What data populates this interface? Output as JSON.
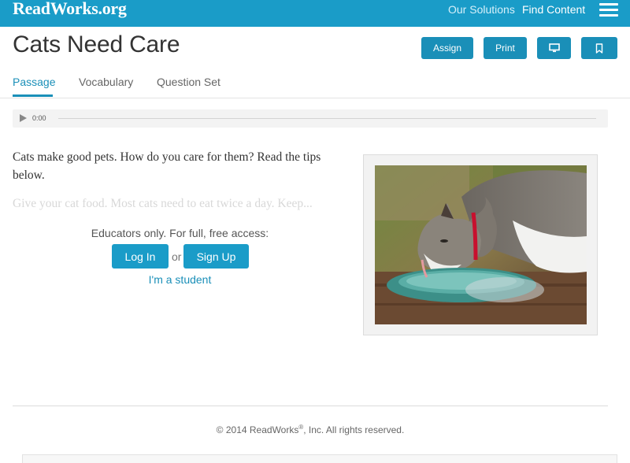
{
  "topbar": {
    "logo": "ReadWorks.org",
    "nav": {
      "solutions": "Our Solutions",
      "find_content": "Find Content"
    }
  },
  "header": {
    "title": "Cats Need Care",
    "buttons": {
      "assign": "Assign",
      "print": "Print"
    }
  },
  "tabs": [
    {
      "label": "Passage",
      "active": true
    },
    {
      "label": "Vocabulary",
      "active": false
    },
    {
      "label": "Question Set",
      "active": false
    }
  ],
  "audio": {
    "time": "0:00"
  },
  "passage": {
    "text": "Cats make good pets. How do you care for them? Read the tips below.",
    "faded_text": "Give your cat food. Most cats need to eat twice a day. Keep..."
  },
  "access": {
    "prompt": "Educators only. For full, free access:",
    "login": "Log In",
    "or": "or",
    "signup": "Sign Up",
    "student": "I'm a student"
  },
  "footer": {
    "copyright_prefix": "© 2014 ReadWorks",
    "registered": "®",
    "copyright_suffix": ", Inc. All rights reserved."
  },
  "colors": {
    "brand": "#1a9cc8",
    "button": "#1a8fb8"
  }
}
